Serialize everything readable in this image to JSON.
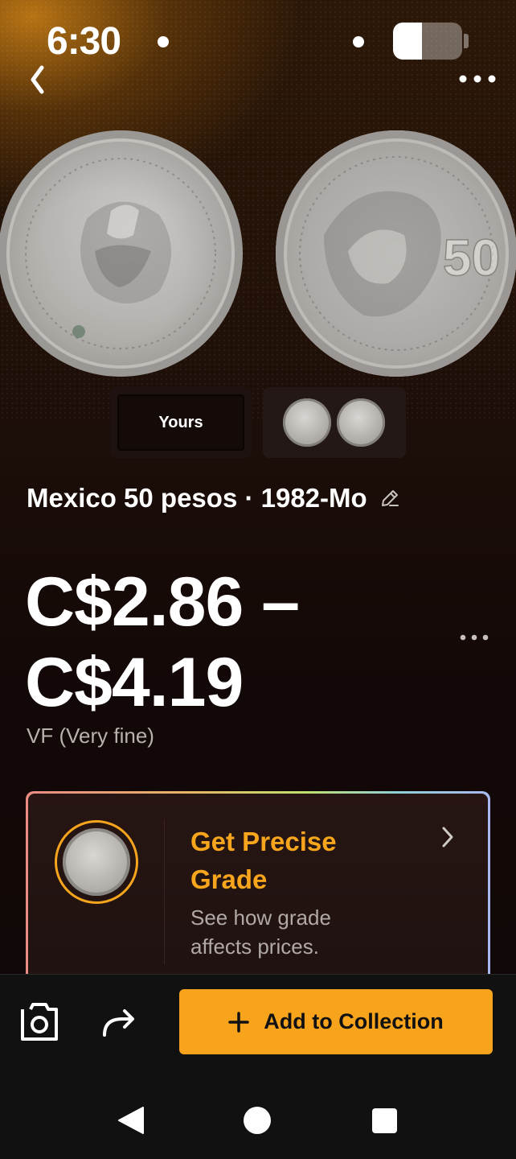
{
  "status_bar": {
    "time": "6:30",
    "battery_level": 0.42
  },
  "header": {
    "back_icon": "chevron-left-icon",
    "more_icon": "more-horizontal-icon"
  },
  "images": {
    "yours_label": "Yours",
    "obverse": "coin-obverse-eagle",
    "reverse": "coin-reverse-50"
  },
  "coin": {
    "title": "Mexico 50 pesos · 1982-Mo",
    "edit_icon": "pencil-icon"
  },
  "price": {
    "range": "C$2.86 – C$4.19",
    "grade": "VF (Very fine)"
  },
  "grade_card": {
    "title": "Get Precise Grade",
    "subtitle": "See how grade affects prices.",
    "chevron_icon": "chevron-right-icon"
  },
  "actions": {
    "camera_icon": "camera-icon",
    "share_icon": "share-icon",
    "add_label": "Add to Collection",
    "accent": "#f7a31c"
  },
  "nav": {
    "back_icon": "triangle-back-icon",
    "home_icon": "circle-home-icon",
    "recents_icon": "square-recents-icon"
  }
}
